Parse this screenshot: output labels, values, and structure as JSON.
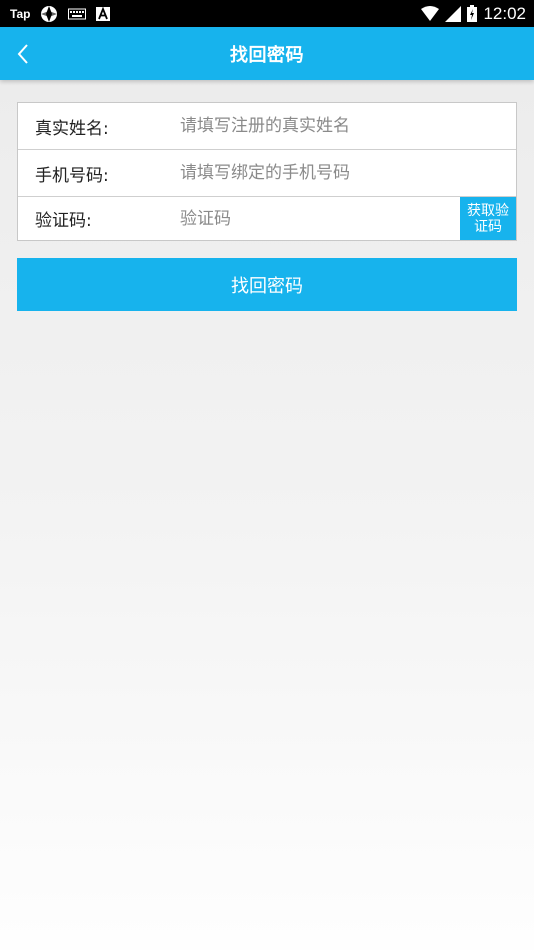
{
  "status_bar": {
    "left_text": "Tap",
    "time": "12:02",
    "icons": [
      "tap-app-icon",
      "aperture-icon",
      "keyboard-icon",
      "a-box-icon",
      "wifi-icon",
      "signal-icon",
      "battery-icon"
    ]
  },
  "header": {
    "title": "找回密码",
    "back_icon": "chevron-left-icon",
    "bg_color": "#17b3ed"
  },
  "form": {
    "name": {
      "label": "真实姓名:",
      "placeholder": "请填写注册的真实姓名",
      "value": ""
    },
    "phone": {
      "label": "手机号码:",
      "placeholder": "请填写绑定的手机号码",
      "value": ""
    },
    "code": {
      "label": "验证码:",
      "placeholder": "验证码",
      "value": "",
      "get_code_label": "获取验证码"
    }
  },
  "submit_label": "找回密码",
  "colors": {
    "accent": "#17b3ed",
    "text": "#222222",
    "placeholder": "#8a8a8a"
  }
}
